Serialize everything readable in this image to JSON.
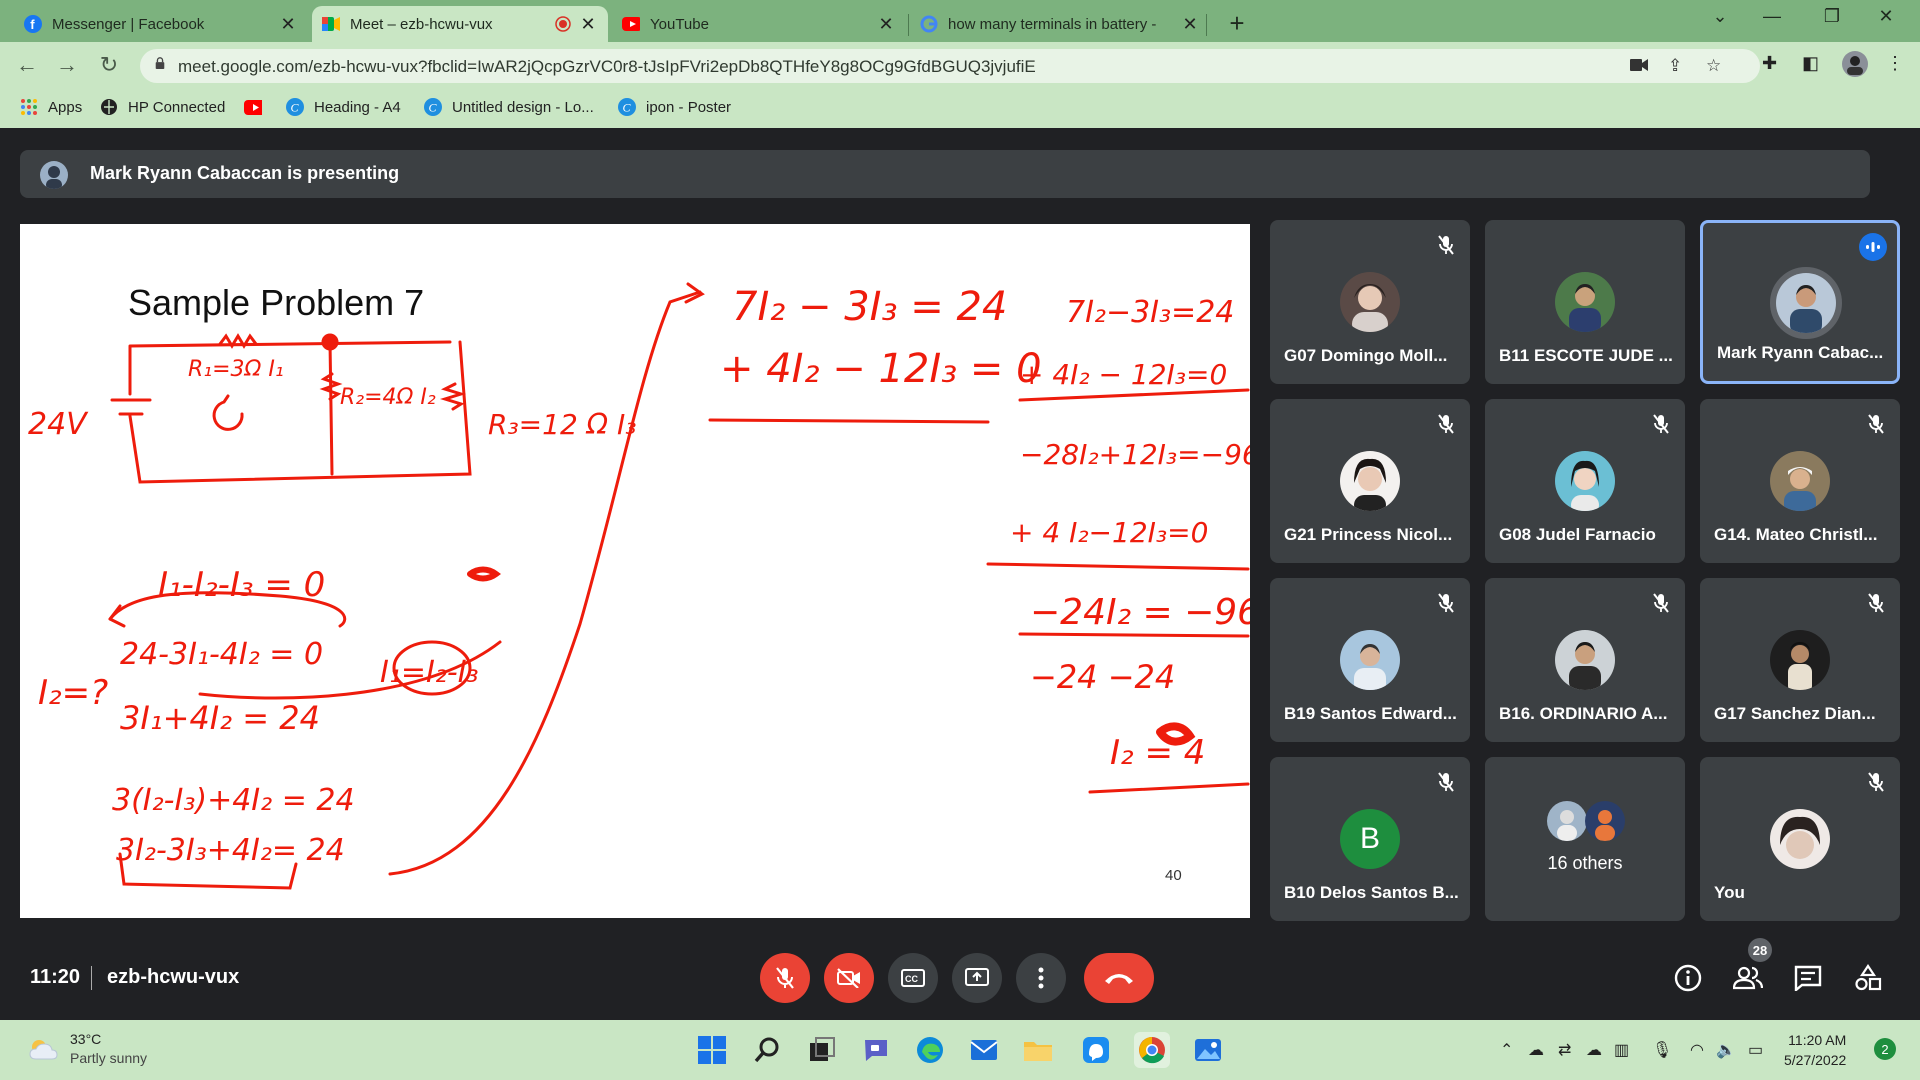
{
  "browser": {
    "tabs": [
      {
        "title": "Messenger | Facebook",
        "icon": "facebook-icon"
      },
      {
        "title": "Meet – ezb-hcwu-vux",
        "icon": "meet-icon",
        "active": true
      },
      {
        "title": "YouTube",
        "icon": "youtube-icon"
      },
      {
        "title": "how many terminals in battery - ",
        "icon": "google-icon"
      }
    ],
    "url": "meet.google.com/ezb-hcwu-vux?fbclid=IwAR2jQcpGzrVC0r8-tJsIpFVri2epDb8QTHfeY8g8OCg9GfdBGUQ3jvjufiE",
    "bookmarks": [
      {
        "label": "Apps",
        "icon": "apps-grid-icon"
      },
      {
        "label": "HP Connected",
        "icon": "globe-icon"
      },
      {
        "label": "",
        "icon": "youtube-icon"
      },
      {
        "label": "Heading - A4",
        "icon": "canva-icon"
      },
      {
        "label": "Untitled design - Lo...",
        "icon": "canva-icon"
      },
      {
        "label": "ipon - Poster",
        "icon": "canva-icon"
      }
    ]
  },
  "meet": {
    "presenting_text": "Mark Ryann Cabaccan is presenting",
    "slide": {
      "title": "Sample Problem 7",
      "page_number": "40"
    },
    "participants": [
      {
        "name": "G07 Domingo Moll...",
        "muted": true
      },
      {
        "name": "B11 ESCOTE JUDE ...",
        "muted": false
      },
      {
        "name": "Mark Ryann Cabac...",
        "muted": false,
        "speaking": true
      },
      {
        "name": "G21 Princess Nicol...",
        "muted": true
      },
      {
        "name": "G08 Judel Farnacio",
        "muted": true
      },
      {
        "name": "G14. Mateo Christl...",
        "muted": true
      },
      {
        "name": "B19 Santos Edward...",
        "muted": true
      },
      {
        "name": "B16. ORDINARIO A...",
        "muted": true
      },
      {
        "name": "G17 Sanchez Dian...",
        "muted": true
      },
      {
        "name": "B10 Delos Santos B...",
        "muted": true,
        "initial": "B"
      },
      {
        "name": "16 others",
        "muted": false
      },
      {
        "name": "You",
        "muted": true
      }
    ],
    "time": "11:20",
    "meeting_code": "ezb-hcwu-vux",
    "participant_count": "28"
  },
  "taskbar": {
    "temperature": "33°C",
    "condition": "Partly sunny",
    "time": "11:20 AM",
    "date": "5/27/2022",
    "notifications": "2"
  },
  "colors": {
    "chrome_frame": "#7cb27e",
    "chrome_toolbar": "#c9e6c4",
    "meet_bg": "#202124",
    "tile_bg": "#3c4043",
    "danger_red": "#ea4335",
    "speaking_blue": "#8ab4f8",
    "ink_red": "#ee1c0c"
  }
}
